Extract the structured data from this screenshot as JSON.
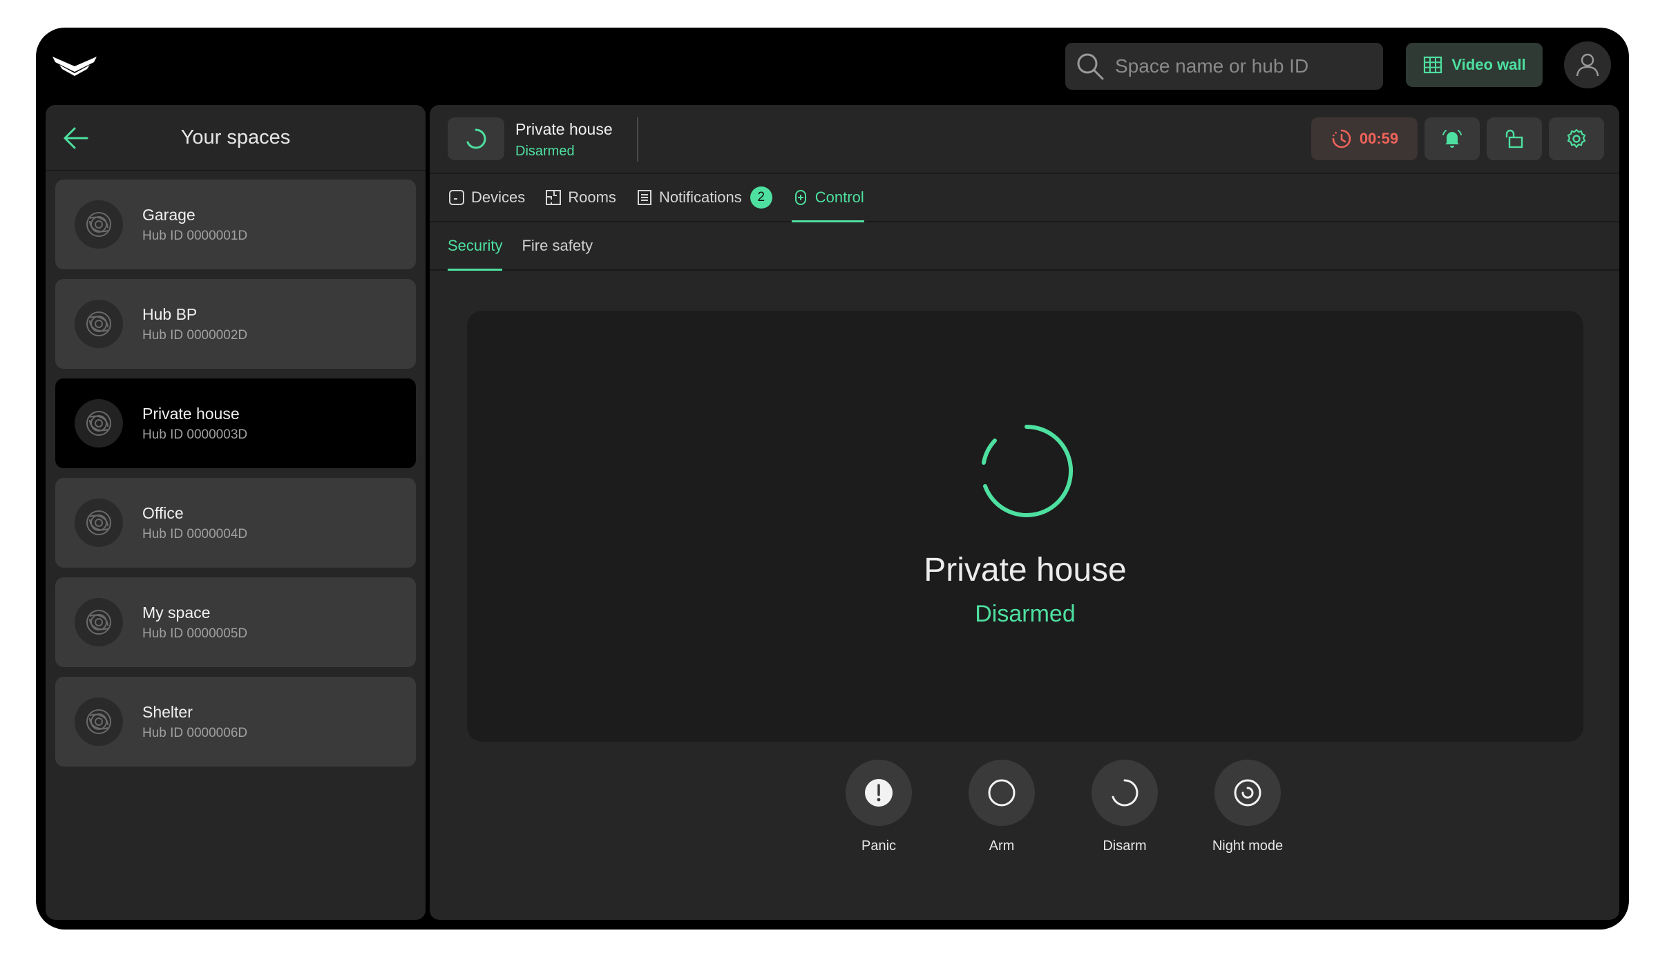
{
  "search": {
    "placeholder": "Space name or hub ID"
  },
  "header": {
    "video_wall_label": "Video wall"
  },
  "sidebar": {
    "title": "Your spaces",
    "items": [
      {
        "name": "Garage",
        "hub": "Hub ID 0000001D"
      },
      {
        "name": "Hub BP",
        "hub": "Hub ID 0000002D"
      },
      {
        "name": "Private house",
        "hub": "Hub ID 0000003D"
      },
      {
        "name": "Office",
        "hub": "Hub ID 0000004D"
      },
      {
        "name": "My space",
        "hub": "Hub ID 0000005D"
      },
      {
        "name": "Shelter",
        "hub": "Hub ID 0000006D"
      }
    ]
  },
  "space_header": {
    "name": "Private house",
    "status": "Disarmed",
    "timer": "00:59"
  },
  "tabs": [
    {
      "label": "Devices"
    },
    {
      "label": "Rooms"
    },
    {
      "label": "Notifications",
      "badge": "2"
    },
    {
      "label": "Control"
    }
  ],
  "subtabs": [
    {
      "label": "Security"
    },
    {
      "label": "Fire safety"
    }
  ],
  "status_card": {
    "name": "Private house",
    "status": "Disarmed"
  },
  "controls": [
    {
      "label": "Panic"
    },
    {
      "label": "Arm"
    },
    {
      "label": "Disarm"
    },
    {
      "label": "Night mode"
    }
  ],
  "colors": {
    "accent": "#4ee0a0",
    "alert": "#f0645a",
    "background": "#000000",
    "panel": "#262626"
  }
}
